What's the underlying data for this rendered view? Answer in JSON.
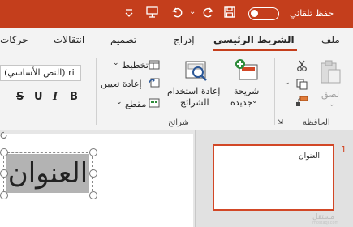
{
  "titlebar": {
    "autosave_label": "حفظ تلقائي",
    "accent_color": "#c43e1c"
  },
  "menu": {
    "tabs": [
      "ملف",
      "الشريط الرئيسي",
      "إدراج",
      "تصميم",
      "انتقالات",
      "حركات"
    ],
    "active_tab": "الشريط الرئيسي"
  },
  "ribbon": {
    "clipboard": {
      "paste_label": "لصق",
      "group_label": "الحافظة"
    },
    "slides": {
      "new_slide_label": "شريحة",
      "new_slide_label_2": "جديدة",
      "reuse_label": "إعادة استخدام",
      "reuse_label_2": "الشرائح",
      "layout_label": "تخطيط",
      "reset_label": "إعادة تعيين",
      "section_label": "مقطع",
      "group_label": "شرائح"
    },
    "font": {
      "font_name": "(النص الأساسي) ri",
      "bold": "B",
      "italic": "I",
      "underline": "U",
      "strike": "S"
    }
  },
  "editor": {
    "title_placeholder": "العنوان"
  },
  "thumbnails": {
    "slide_number": "1",
    "slide_title": "العنوان"
  },
  "watermark": {
    "text": "مستقل",
    "sub": "mostaql.com"
  }
}
